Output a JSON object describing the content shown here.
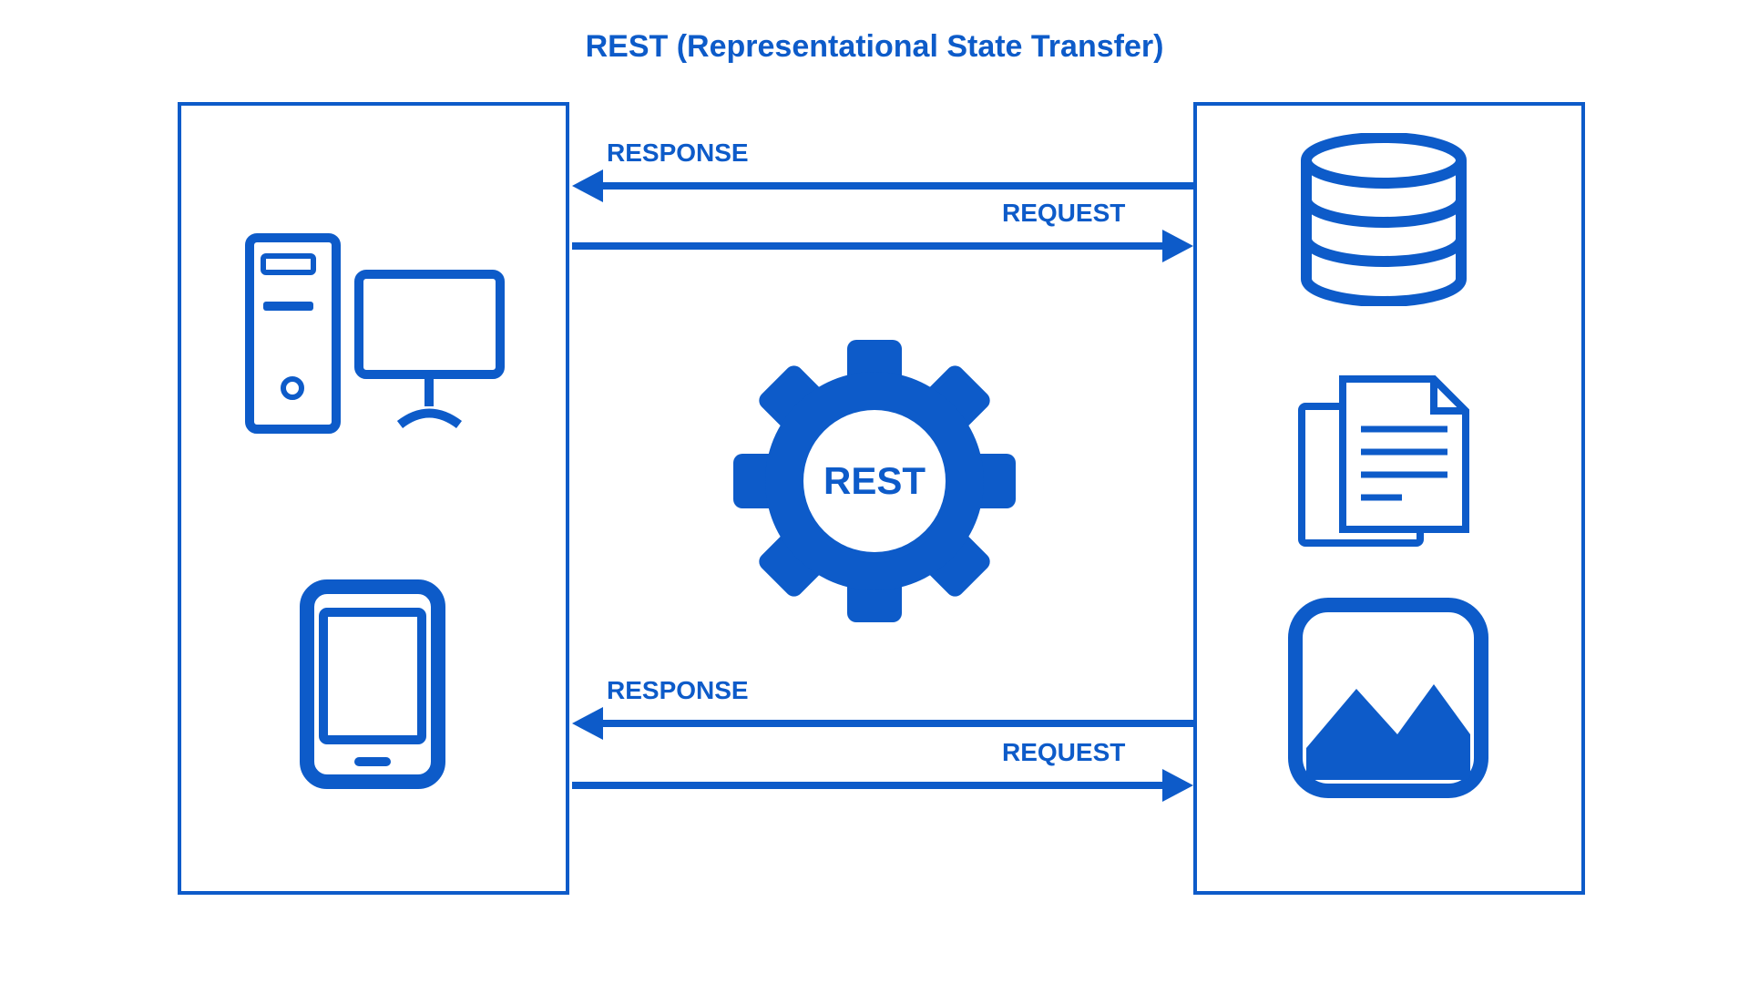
{
  "title": "REST (Representational State Transfer)",
  "gear_label": "REST",
  "arrows": {
    "top_response": "RESPONSE",
    "top_request": "REQUEST",
    "bottom_response": "RESPONSE",
    "bottom_request": "REQUEST"
  },
  "colors": {
    "primary": "#0d5bc9"
  }
}
